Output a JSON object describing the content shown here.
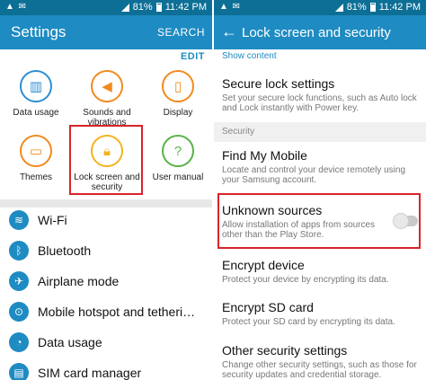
{
  "status": {
    "signal": "81%",
    "time": "11:42 PM"
  },
  "left": {
    "title": "Settings",
    "search_label": "SEARCH",
    "edit_label": "EDIT",
    "grid": [
      {
        "label": "Data usage",
        "icon": "bar-chart-icon",
        "color": "#2d8fd2"
      },
      {
        "label": "Sounds and vibrations",
        "icon": "speaker-icon",
        "color": "#f28a1e"
      },
      {
        "label": "Display",
        "icon": "phone-display-icon",
        "color": "#f28a1e"
      },
      {
        "label": "Themes",
        "icon": "brush-icon",
        "color": "#f28a1e"
      },
      {
        "label": "Lock screen and security",
        "icon": "lock-icon",
        "color": "#f2b41e"
      },
      {
        "label": "User manual",
        "icon": "help-icon",
        "color": "#58b247"
      }
    ],
    "list": [
      {
        "label": "Wi-Fi",
        "icon": "wifi-icon"
      },
      {
        "label": "Bluetooth",
        "icon": "bluetooth-icon"
      },
      {
        "label": "Airplane mode",
        "icon": "airplane-icon"
      },
      {
        "label": "Mobile hotspot and tetheri…",
        "icon": "hotspot-icon"
      },
      {
        "label": "Data usage",
        "icon": "data-usage-icon"
      },
      {
        "label": "SIM card manager",
        "icon": "sim-icon"
      }
    ]
  },
  "right": {
    "title": "Lock screen and security",
    "show_content": "Show content",
    "security_header": "Security",
    "options": [
      {
        "title": "Secure lock settings",
        "desc": "Set your secure lock functions, such as Auto lock and Lock instantly with Power key."
      },
      {
        "title": "Find My Mobile",
        "desc": "Locate and control your device remotely using your Samsung account."
      },
      {
        "title": "Unknown sources",
        "desc": "Allow installation of apps from sources other than the Play Store."
      },
      {
        "title": "Encrypt device",
        "desc": "Protect your device by encrypting its data."
      },
      {
        "title": "Encrypt SD card",
        "desc": "Protect your SD card by encrypting its data."
      },
      {
        "title": "Other security settings",
        "desc": "Change other security settings, such as those for security updates and credential storage."
      }
    ]
  },
  "colors": {
    "appbar": "#1e8bc2",
    "statusbar": "#0d6f96",
    "highlight": "#d8232a"
  }
}
